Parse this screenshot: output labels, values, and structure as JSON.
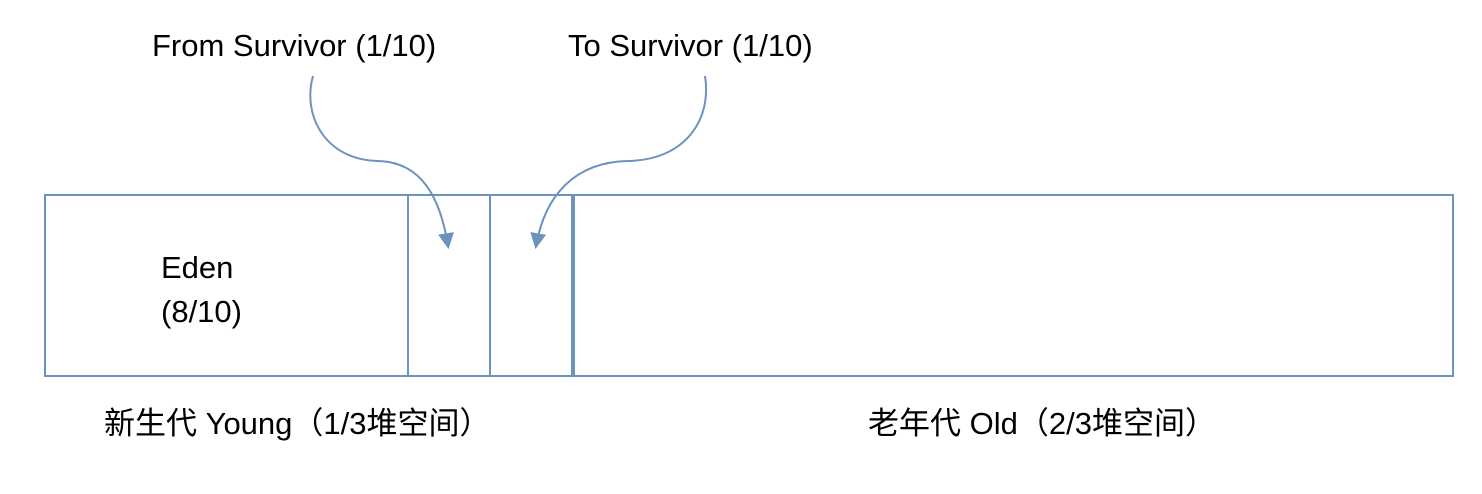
{
  "labels": {
    "from_survivor": "From Survivor (1/10)",
    "to_survivor": "To Survivor (1/10)",
    "eden_name": "Eden",
    "eden_ratio": "(8/10)",
    "young": "新生代 Young（1/3堆空间）",
    "old": "老年代 Old（2/3堆空间）"
  },
  "colors": {
    "accent": "#6c92c0",
    "text": "#000000",
    "background": "#ffffff"
  }
}
